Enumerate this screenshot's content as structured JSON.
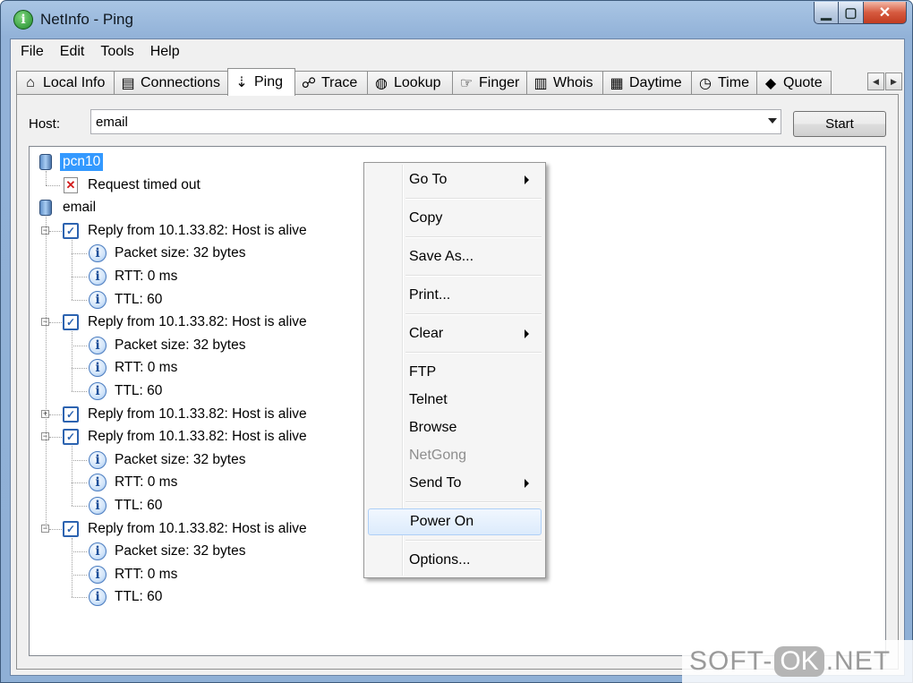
{
  "window": {
    "title": "NetInfo - Ping",
    "minimize_label": "▁",
    "maximize_label": "▢",
    "close_label": "✕"
  },
  "menu": [
    "File",
    "Edit",
    "Tools",
    "Help"
  ],
  "tabs": [
    {
      "label": "Local Info",
      "icon": "house-icon",
      "glyph": "⌂"
    },
    {
      "label": "Connections",
      "icon": "connections-icon",
      "glyph": "▤"
    },
    {
      "label": "Ping",
      "icon": "ping-icon",
      "glyph": "⇣",
      "active": true
    },
    {
      "label": "Trace",
      "icon": "trace-icon",
      "glyph": "☍"
    },
    {
      "label": "Lookup",
      "icon": "globe-icon",
      "glyph": "◍"
    },
    {
      "label": "Finger",
      "icon": "finger-icon",
      "glyph": "☞"
    },
    {
      "label": "Whois",
      "icon": "book-icon",
      "glyph": "▥"
    },
    {
      "label": "Daytime",
      "icon": "calendar-icon",
      "glyph": "▦"
    },
    {
      "label": "Time",
      "icon": "clock-icon",
      "glyph": "◷"
    },
    {
      "label": "Quote",
      "icon": "quote-book-icon",
      "glyph": "◆"
    }
  ],
  "tab_scroll": {
    "left": "◀",
    "right": "▶"
  },
  "host": {
    "label": "Host:",
    "value": "email"
  },
  "start_button": "Start",
  "tree": {
    "hosts": [
      {
        "name": "pcn10",
        "selected": true,
        "children": [
          {
            "type": "error",
            "text": "Request timed out"
          }
        ]
      },
      {
        "name": "email",
        "children": [
          {
            "type": "reply",
            "text": "Reply from 10.1.33.82: Host is alive",
            "expanded": true,
            "details": [
              "Packet size: 32 bytes",
              "RTT: 0 ms",
              "TTL: 60"
            ]
          },
          {
            "type": "reply",
            "text": "Reply from 10.1.33.82: Host is alive",
            "expanded": true,
            "details": [
              "Packet size: 32 bytes",
              "RTT: 0 ms",
              "TTL: 60"
            ]
          },
          {
            "type": "reply",
            "text": "Reply from 10.1.33.82: Host is alive",
            "expanded": false,
            "details": []
          },
          {
            "type": "reply",
            "text": "Reply from 10.1.33.82: Host is alive",
            "expanded": true,
            "details": [
              "Packet size: 32 bytes",
              "RTT: 0 ms",
              "TTL: 60"
            ]
          },
          {
            "type": "reply",
            "text": "Reply from 10.1.33.82: Host is alive",
            "expanded": true,
            "details": [
              "Packet size: 32 bytes",
              "RTT: 0 ms",
              "TTL: 60"
            ]
          }
        ]
      }
    ]
  },
  "context_menu": [
    {
      "label": "Go To",
      "submenu": true
    },
    {
      "sep": true
    },
    {
      "label": "Copy"
    },
    {
      "sep": true
    },
    {
      "label": "Save As..."
    },
    {
      "sep": true
    },
    {
      "label": "Print..."
    },
    {
      "sep": true
    },
    {
      "label": "Clear",
      "submenu": true
    },
    {
      "sep": true
    },
    {
      "label": "FTP"
    },
    {
      "label": "Telnet"
    },
    {
      "label": "Browse"
    },
    {
      "label": "NetGong",
      "disabled": true
    },
    {
      "label": "Send To",
      "submenu": true
    },
    {
      "sep": true
    },
    {
      "label": "Power On",
      "hover": true
    },
    {
      "sep": true
    },
    {
      "label": "Options..."
    }
  ],
  "watermark": {
    "part1": "SOFT-",
    "part2": "OK",
    "part3": ".NET"
  }
}
